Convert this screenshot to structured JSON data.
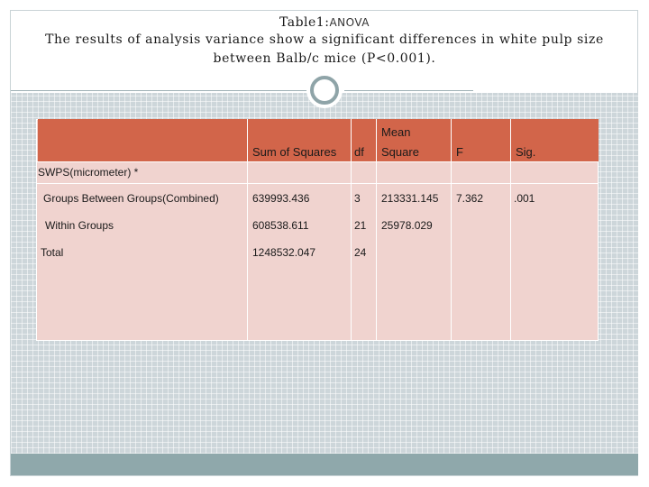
{
  "title": {
    "prefix": "Table1:",
    "suffix": "ANOVA",
    "line2": "The results of analysis variance show a significant differences in white pulp size",
    "line3": "between Balb/c mice (P<0.001)."
  },
  "table": {
    "headers": {
      "sum_of_squares": "Sum of Squares",
      "df": "df",
      "mean_square_line1": "Mean",
      "mean_square_line2": "Square",
      "f": "F",
      "sig": "Sig."
    },
    "group_label": "SWPS(micrometer) *",
    "rows": [
      {
        "label": "Groups Between Groups(Combined)",
        "sum_of_squares": "639993.436",
        "df": "3",
        "mean_square": "213331.145",
        "f": "7.362",
        "sig": ".001"
      },
      {
        "label": "Within Groups",
        "sum_of_squares": "608538.611",
        "df": "21",
        "mean_square": "25978.029",
        "f": "",
        "sig": ""
      },
      {
        "label": "Total",
        "sum_of_squares": "1248532.047",
        "df": "24",
        "mean_square": "",
        "f": "",
        "sig": ""
      }
    ]
  },
  "colors": {
    "header": "#d2654a",
    "table_body": "#f0d3cf",
    "pattern": "#cdd6da",
    "footer_bar": "#8fa8ab"
  }
}
